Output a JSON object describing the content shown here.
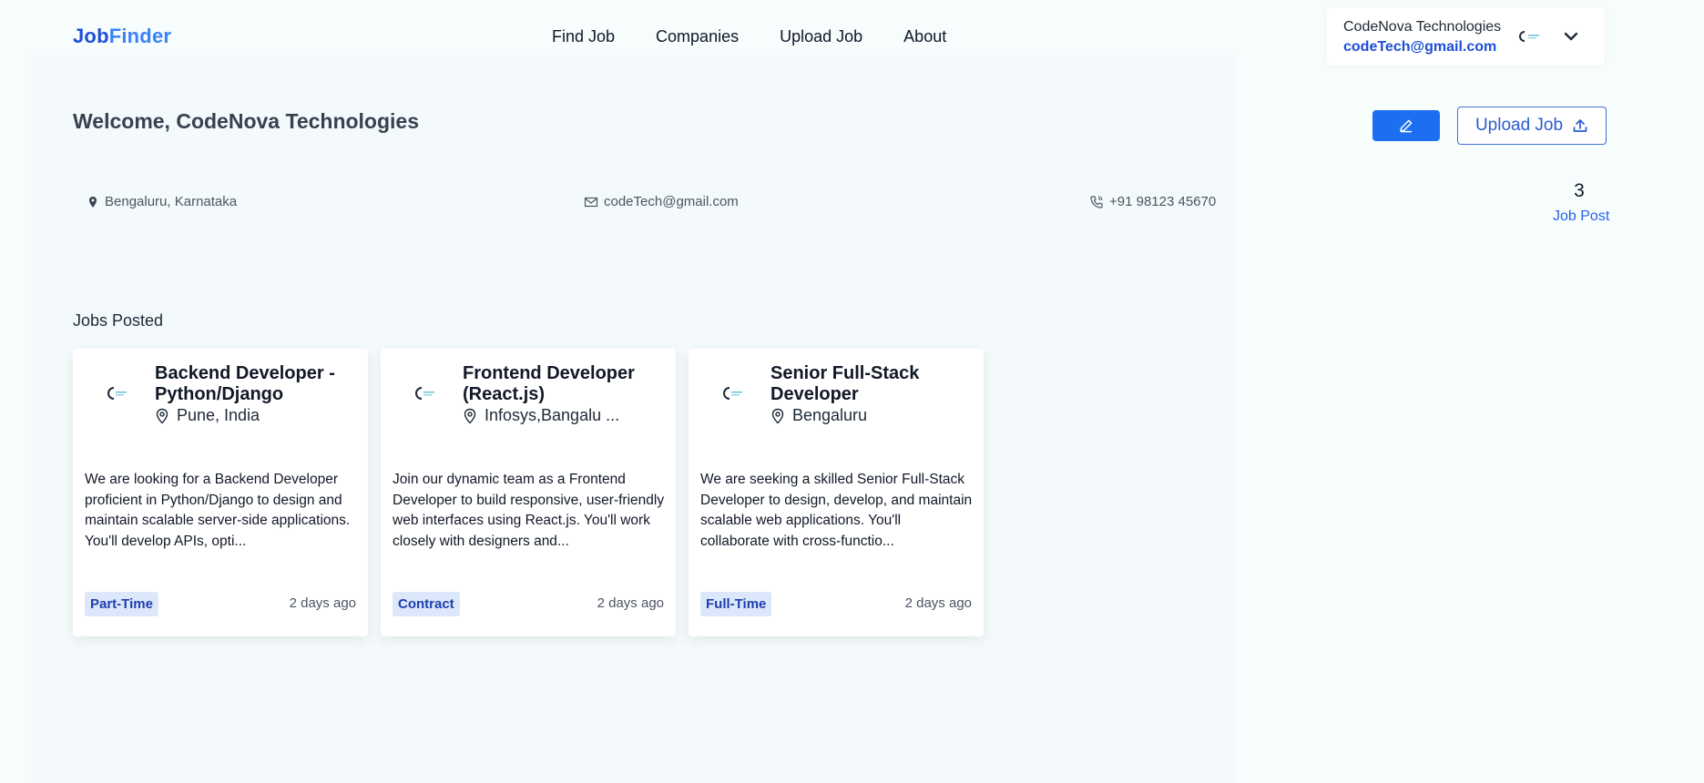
{
  "header": {
    "logo_part1": "Job",
    "logo_part2": "Finder",
    "nav": [
      "Find Job",
      "Companies",
      "Upload Job",
      "About"
    ],
    "profile": {
      "name": "CodeNova Technologies",
      "email": "codeTech@gmail.com"
    }
  },
  "welcome": "Welcome, CodeNova Technologies",
  "actions": {
    "upload_label": "Upload Job"
  },
  "info": {
    "location": "Bengaluru, Karnataka",
    "email": "codeTech@gmail.com",
    "phone": "+91 98123 45670",
    "job_post_count": "3",
    "job_post_label": "Job Post"
  },
  "jobs_section_title": "Jobs Posted",
  "jobs": [
    {
      "title": "Backend Developer - Python/Django",
      "location": "Pune, India",
      "description": "We are looking for a Backend Developer proficient in Python/Django to design and maintain scalable server-side applications. You'll develop APIs, opti...",
      "type": "Part-Time",
      "posted": "2 days ago"
    },
    {
      "title": "Frontend Developer (React.js)",
      "location": "Infosys,Bangalu ...",
      "description": "Join our dynamic team as a Frontend Developer to build responsive, user-friendly web interfaces using React.js. You'll work closely with designers and...",
      "type": "Contract",
      "posted": "2 days ago"
    },
    {
      "title": "Senior Full-Stack Developer",
      "location": "Bengaluru",
      "description": "We are seeking a skilled Senior Full-Stack Developer to design, develop, and maintain scalable web applications. You'll collaborate with cross-functio...",
      "type": "Full-Time",
      "posted": "2 days ago"
    }
  ],
  "colors": {
    "primary": "#1d6ff2",
    "link": "#2563eb",
    "tag_bg": "#dde7fb",
    "tag_text": "#1e40af"
  }
}
